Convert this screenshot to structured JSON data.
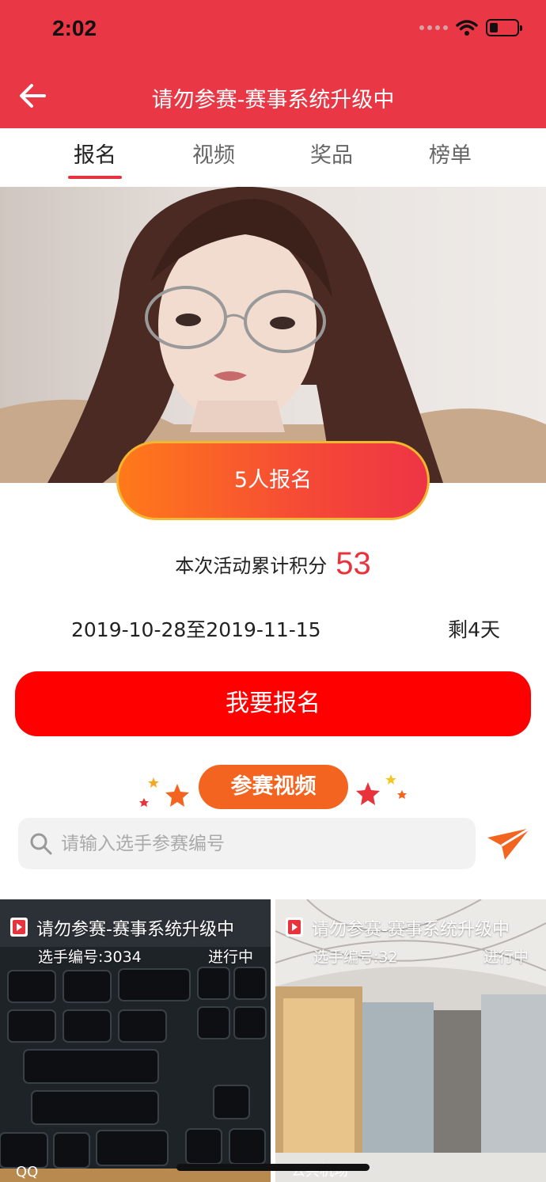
{
  "status_bar": {
    "time": "2:02"
  },
  "nav": {
    "title": "请勿参赛-赛事系统升级中",
    "back_icon": "arrow-left-icon"
  },
  "tabs": [
    {
      "label": "报名",
      "active": true
    },
    {
      "label": "视频",
      "active": false
    },
    {
      "label": "奖品",
      "active": false
    },
    {
      "label": "榜单",
      "active": false
    }
  ],
  "signup": {
    "count_label": "5人报名"
  },
  "points": {
    "label": "本次活动累计积分",
    "value": "53"
  },
  "period": {
    "range": "2019-10-28至2019-11-15",
    "remaining": "剩4天"
  },
  "join_button": {
    "label": "我要报名"
  },
  "section": {
    "title": "参赛视频"
  },
  "search": {
    "placeholder": "请输入选手参赛编号",
    "value": ""
  },
  "videos": [
    {
      "title": "请勿参赛-赛事系统升级中",
      "number": "选手编号:3034",
      "status": "进行中",
      "caption": "QQ"
    },
    {
      "title": "请勿参赛-赛事系统升级中",
      "number": "选手编号:32",
      "status": "进行中",
      "caption": "公共机场"
    }
  ],
  "colors": {
    "brand_red": "#ea3745",
    "accent_orange": "#f36420",
    "button_red": "#ff0000",
    "points_red": "#e8323c"
  }
}
